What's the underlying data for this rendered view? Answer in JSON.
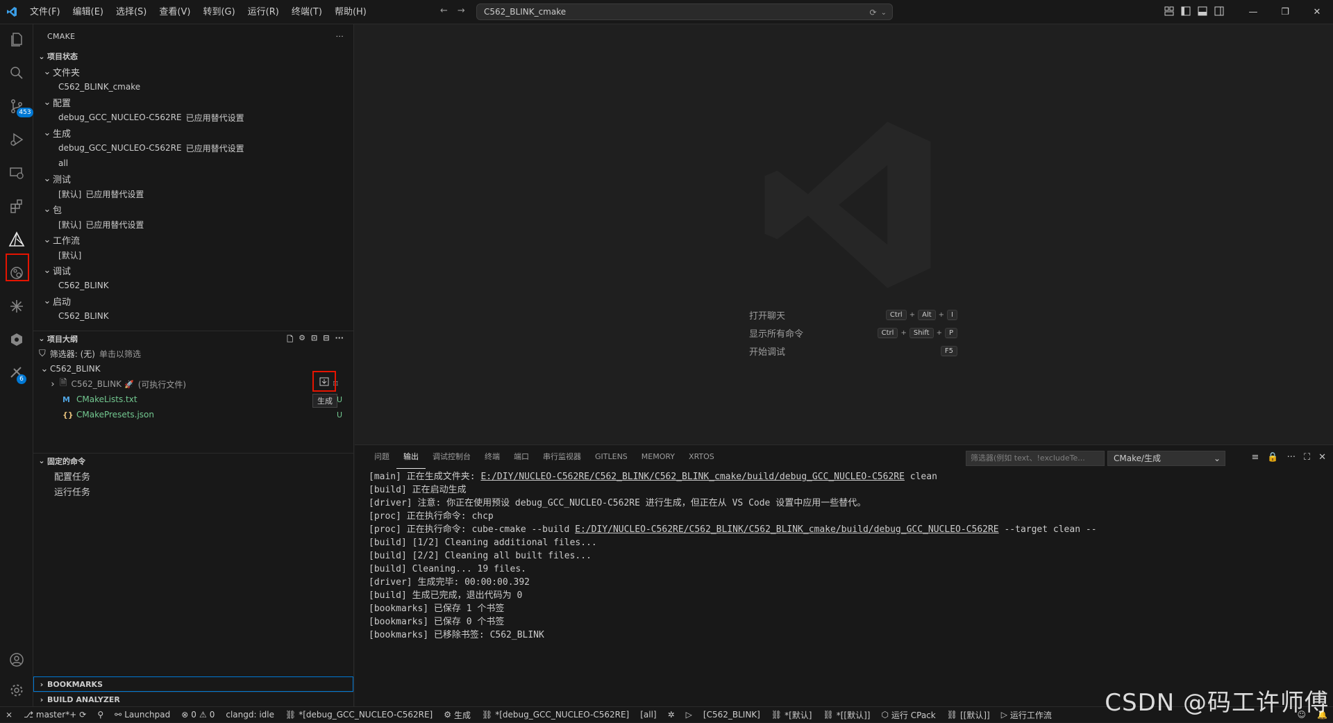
{
  "titlebar": {
    "menus": [
      "文件(F)",
      "编辑(E)",
      "选择(S)",
      "查看(V)",
      "转到(G)",
      "运行(R)",
      "终端(T)",
      "帮助(H)"
    ],
    "search_text": "C562_BLINK_cmake"
  },
  "activitybar": {
    "scm_badge": "453",
    "extension_badge": "6"
  },
  "sidebar": {
    "title": "CMAKE",
    "project_status": {
      "header": "项目状态",
      "groups": [
        {
          "label": "文件夹",
          "items": [
            {
              "text": "C562_BLINK_cmake",
              "note": ""
            }
          ]
        },
        {
          "label": "配置",
          "items": [
            {
              "text": "debug_GCC_NUCLEO-C562RE",
              "note": "已应用替代设置"
            }
          ]
        },
        {
          "label": "生成",
          "items": [
            {
              "text": "debug_GCC_NUCLEO-C562RE",
              "note": "已应用替代设置"
            },
            {
              "text": "all",
              "note": ""
            }
          ]
        },
        {
          "label": "测试",
          "items": [
            {
              "text": "[默认]",
              "note": "已应用替代设置"
            }
          ]
        },
        {
          "label": "包",
          "items": [
            {
              "text": "[默认]",
              "note": "已应用替代设置"
            }
          ]
        },
        {
          "label": "工作流",
          "items": [
            {
              "text": "[默认]",
              "note": ""
            }
          ]
        },
        {
          "label": "调试",
          "items": [
            {
              "text": "C562_BLINK",
              "note": ""
            }
          ]
        },
        {
          "label": "启动",
          "items": [
            {
              "text": "C562_BLINK",
              "note": ""
            }
          ]
        }
      ]
    },
    "outline": {
      "header": "项目大纲",
      "filter_label": "筛选器: (无)",
      "filter_hint": "单击以筛选",
      "project": "C562_BLINK",
      "target": "C562_BLINK",
      "target_kind": "(可执行文件)",
      "files": [
        {
          "name": "CMakeLists.txt",
          "status": "U"
        },
        {
          "name": "CMakePresets.json",
          "status": "U"
        }
      ],
      "build_tooltip": "生成"
    },
    "pinned": {
      "header": "固定的命令",
      "items": [
        "配置任务",
        "运行任务"
      ]
    },
    "bookmarks_header": "BOOKMARKS",
    "build_analyzer_header": "BUILD ANALYZER"
  },
  "editor": {
    "shortcuts": [
      {
        "label": "打开聊天",
        "keys": [
          "Ctrl",
          "Alt",
          "I"
        ]
      },
      {
        "label": "显示所有命令",
        "keys": [
          "Ctrl",
          "Shift",
          "P"
        ]
      },
      {
        "label": "开始调试",
        "keys": [
          "F5"
        ]
      }
    ]
  },
  "panel": {
    "tabs": [
      "问题",
      "输出",
      "调试控制台",
      "终端",
      "端口",
      "串行监视器",
      "GITLENS",
      "MEMORY",
      "XRTOS"
    ],
    "active_tab": "输出",
    "filter_placeholder": "筛选器(例如 text、!excludeTe...",
    "output_channel": "CMake/生成",
    "lines": [
      {
        "pre": "[main] 正在生成文件夹: ",
        "link": "E:/DIY/NUCLEO-C562RE/C562_BLINK/C562_BLINK_cmake/build/debug_GCC_NUCLEO-C562RE",
        "post": " clean"
      },
      {
        "pre": "[build] 正在启动生成",
        "link": "",
        "post": ""
      },
      {
        "pre": "[driver] 注意: 你正在使用预设 debug_GCC_NUCLEO-C562RE 进行生成，但正在从 VS Code 设置中应用一些替代。",
        "link": "",
        "post": ""
      },
      {
        "pre": "[proc] 正在执行命令: chcp",
        "link": "",
        "post": ""
      },
      {
        "pre": "[proc] 正在执行命令: cube-cmake --build ",
        "link": "E:/DIY/NUCLEO-C562RE/C562_BLINK/C562_BLINK_cmake/build/debug_GCC_NUCLEO-C562RE",
        "post": " --target clean --"
      },
      {
        "pre": "[build] [1/2] Cleaning additional files...",
        "link": "",
        "post": ""
      },
      {
        "pre": "[build] [2/2] Cleaning all built files...",
        "link": "",
        "post": ""
      },
      {
        "pre": "[build] Cleaning... 19 files.",
        "link": "",
        "post": ""
      },
      {
        "pre": "[driver] 生成完毕: 00:00:00.392",
        "link": "",
        "post": ""
      },
      {
        "pre": "[build] 生成已完成，退出代码为 0",
        "link": "",
        "post": ""
      },
      {
        "pre": "[bookmarks] 已保存 1 个书签",
        "link": "",
        "post": ""
      },
      {
        "pre": "[bookmarks] 已保存 0 个书签",
        "link": "",
        "post": ""
      },
      {
        "pre": "[bookmarks] 已移除书签: C562_BLINK",
        "link": "",
        "post": ""
      }
    ]
  },
  "statusbar": {
    "branch": "master*+",
    "launchpad": "Launchpad",
    "errors": "0",
    "warnings": "0",
    "clangd": "clangd: idle",
    "config_preset": "*[debug_GCC_NUCLEO-C562RE]",
    "build_label": "生成",
    "build_preset": "*[debug_GCC_NUCLEO-C562RE]",
    "target": "[all]",
    "launch_target": "[C562_BLINK]",
    "test_preset": "*[默认]",
    "package_preset": "*[[默认]]",
    "cpack": "运行 CPack",
    "workflow_preset": "[[默认]]",
    "run_workflow": "运行工作流"
  },
  "watermark": "CSDN @码工许师傅",
  "colors": {
    "accent": "#0078d4",
    "highlight_box": "#e51400",
    "untracked_green": "#73c991"
  }
}
